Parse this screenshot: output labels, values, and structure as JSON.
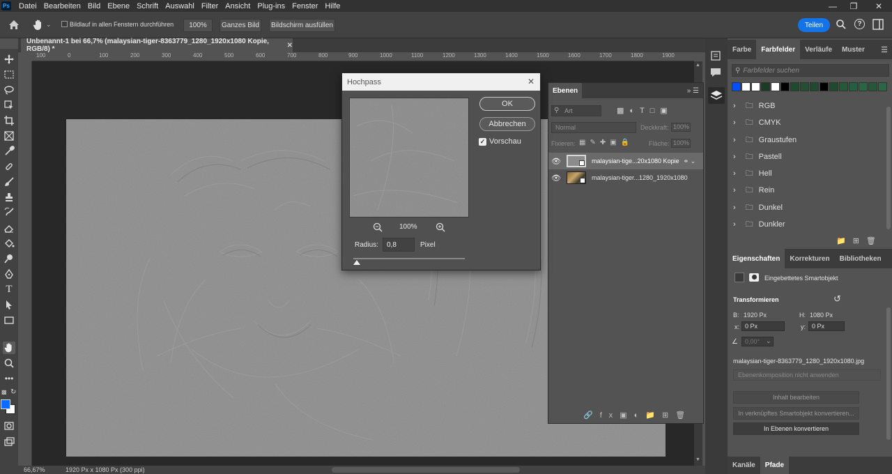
{
  "menu": [
    "Datei",
    "Bearbeiten",
    "Bild",
    "Ebene",
    "Schrift",
    "Auswahl",
    "Filter",
    "Ansicht",
    "Plug-ins",
    "Fenster",
    "Hilfe"
  ],
  "app_logo": "Ps",
  "options": {
    "scroll_all_label": "Bildlauf in allen Fenstern durchführen",
    "zoom_btn": "100%",
    "fit_btn": "Ganzes Bild",
    "fill_btn": "Bildschirm ausfüllen",
    "share": "Teilen"
  },
  "document": {
    "tab_title": "Unbenannt-1 bei 66,7% (malaysian-tiger-8363779_1280_1920x1080 Kopie, RGB/8) *",
    "hruler_ticks": [
      "100",
      "0",
      "100",
      "200",
      "300",
      "400",
      "500",
      "600",
      "700",
      "800",
      "900",
      "1000",
      "1100",
      "1200",
      "1300",
      "1400",
      "1500",
      "1600",
      "1700",
      "1800",
      "1900"
    ],
    "status_zoom": "66,67%",
    "status_info": "1920 Px x 1080 Px (300 ppi)"
  },
  "dialog": {
    "title": "Hochpass",
    "ok": "OK",
    "cancel": "Abbrechen",
    "preview_label": "Vorschau",
    "zoom": "100%",
    "radius_label": "Radius:",
    "radius_value": "0,8",
    "radius_unit": "Pixel"
  },
  "layers": {
    "tab": "Ebenen",
    "filter_placeholder": "Art",
    "blend_mode": "Normal",
    "opacity_label": "Deckkraft:",
    "opacity_value": "100%",
    "lock_label": "Fixieren:",
    "fill_label": "Fläche:",
    "fill_value": "100%",
    "items": [
      {
        "name": "malaysian-tige...20x1080 Kopie"
      },
      {
        "name": "malaysian-tiger...1280_1920x1080"
      }
    ]
  },
  "swatches": {
    "tabs": [
      "Farbe",
      "Farbfelder",
      "Verläufe",
      "Muster"
    ],
    "search_placeholder": "Farbfelder suchen",
    "colors": [
      "#0050ff",
      "#ffffff",
      "#ffffff",
      "#1c3b24",
      "#ffffff",
      "#000000",
      "#1e4a2e",
      "#234f33",
      "#1f4a30",
      "#000000",
      "#1f4a2f",
      "#245a38",
      "#226040",
      "#2a6644",
      "#255838",
      "#2c6645"
    ],
    "groups": [
      "RGB",
      "CMYK",
      "Graustufen",
      "Pastell",
      "Hell",
      "Rein",
      "Dunkel",
      "Dunkler"
    ]
  },
  "properties": {
    "tabs": [
      "Eigenschaften",
      "Korrekturen",
      "Bibliotheken"
    ],
    "type": "Eingebettetes Smartobjekt",
    "transform_label": "Transformieren",
    "w_label": "B:",
    "w_value": "1920 Px",
    "h_label": "H:",
    "h_value": "1080 Px",
    "x_label": "x:",
    "x_value": "0 Px",
    "y_label": "y:",
    "y_value": "0 Px",
    "angle_value": "0,00°",
    "filename": "malaysian-tiger-8363779_1280_1920x1080.jpg",
    "comp_placeholder": "Ebenenkomposition nicht anwenden",
    "edit_btn": "Inhalt bearbeiten",
    "convert_linked_btn": "In verknüpftes Smartobjekt konvertieren...",
    "convert_layers_btn": "In Ebenen konvertieren"
  },
  "bottom_tabs": [
    "Kanäle",
    "Pfade"
  ]
}
